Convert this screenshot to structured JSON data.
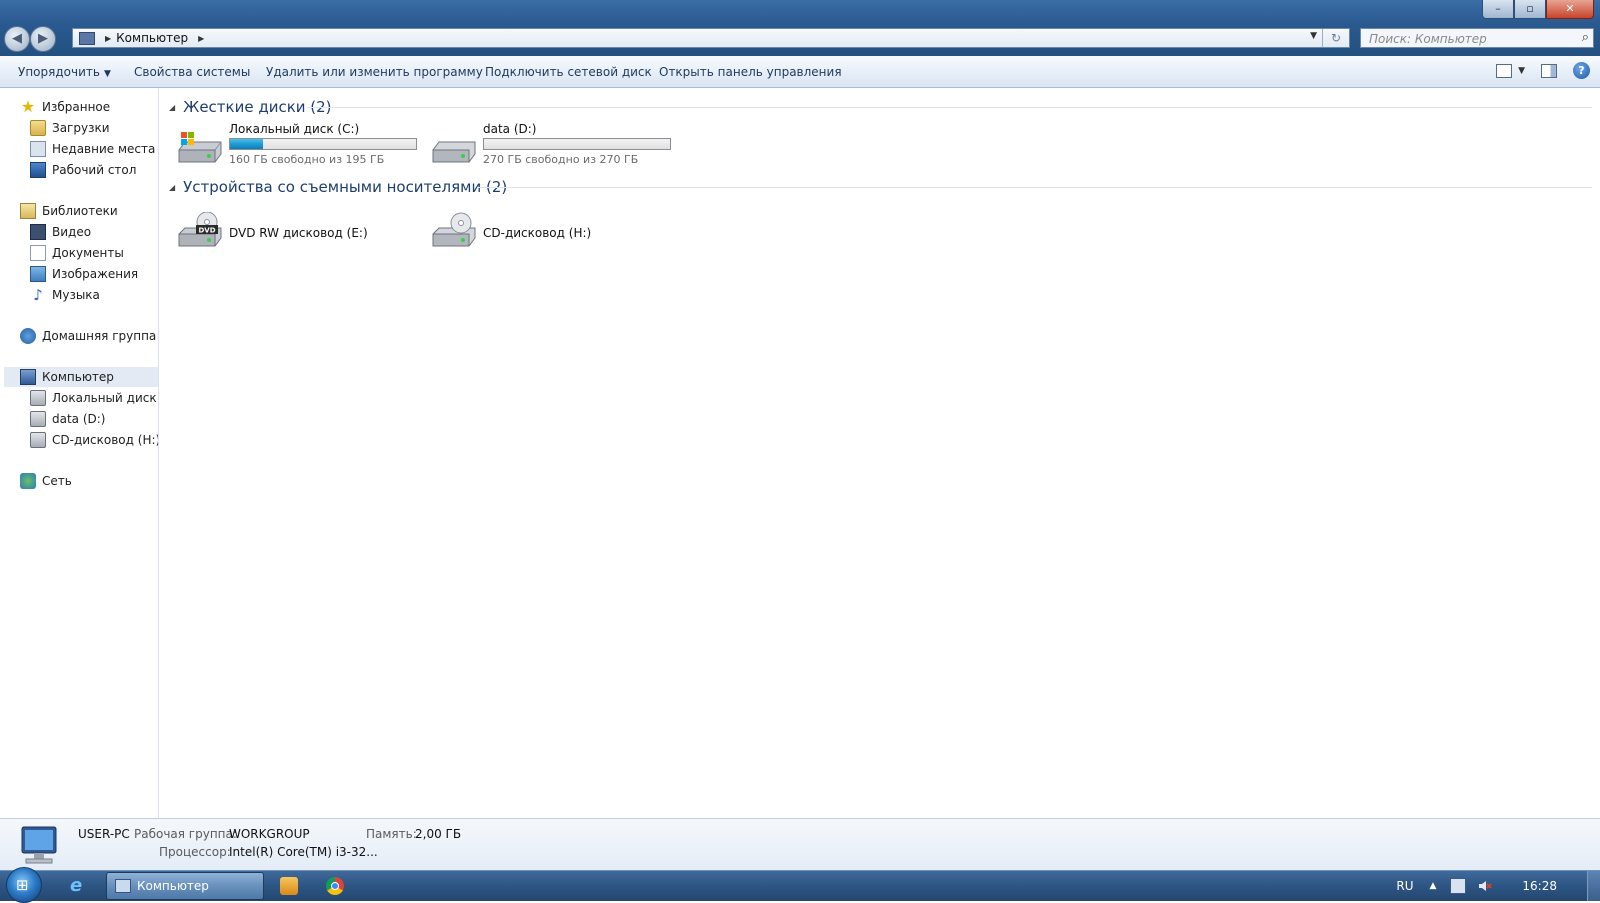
{
  "window": {
    "minimize_glyph": "–",
    "maximize_glyph": "▫",
    "close_glyph": "✕"
  },
  "address": {
    "breadcrumb": "Компьютер",
    "search_placeholder": "Поиск: Компьютер"
  },
  "toolbar": {
    "organize": "Упорядочить",
    "system_properties": "Свойства системы",
    "uninstall": "Удалить или изменить программу",
    "map_drive": "Подключить сетевой диск",
    "control_panel": "Открыть панель управления",
    "icons": [
      "view-options-icon",
      "preview-pane-icon",
      "help-icon"
    ]
  },
  "nav": {
    "favorites": "Избранное",
    "downloads": "Загрузки",
    "recent": "Недавние места",
    "desktop": "Рабочий стол",
    "libraries": "Библиотеки",
    "video": "Видео",
    "documents": "Документы",
    "pictures": "Изображения",
    "music": "Музыка",
    "homegroup": "Домашняя группа",
    "computer": "Компьютер",
    "drive_c": "Локальный диск (C",
    "drive_d": "data (D:)",
    "drive_h": "CD-дисковод (H:)",
    "network": "Сеть"
  },
  "groups": {
    "hard_disks": "Жесткие диски (2)",
    "removable": "Устройства со съемными носителями (2)"
  },
  "drives": [
    {
      "name": "Локальный диск (C:)",
      "free": "160 ГБ свободно из 195 ГБ",
      "used_fraction": 0.18
    },
    {
      "name": "data (D:)",
      "free": "270 ГБ свободно из 270 ГБ",
      "used_fraction": 0.0
    }
  ],
  "removable": [
    {
      "name": "DVD RW дисковод (E:)",
      "badge": "DVD"
    },
    {
      "name": "CD-дисковод (H:)"
    }
  ],
  "details": {
    "name": "USER-PC",
    "workgroup_label": "Рабочая группа:",
    "workgroup_value": "WORKGROUP",
    "memory_label": "Память:",
    "memory_value": "2,00 ГБ",
    "cpu_label": "Процессор:",
    "cpu_value": "Intel(R) Core(TM) i3-32..."
  },
  "taskbar": {
    "active_task": "Компьютер",
    "lang": "RU",
    "time": "16:28"
  },
  "colors": {
    "titlebar": "#2a5a90",
    "progress_fill": "#1c9cd6",
    "group_header": "#1e3e6e",
    "link_text": "#1e395b"
  }
}
